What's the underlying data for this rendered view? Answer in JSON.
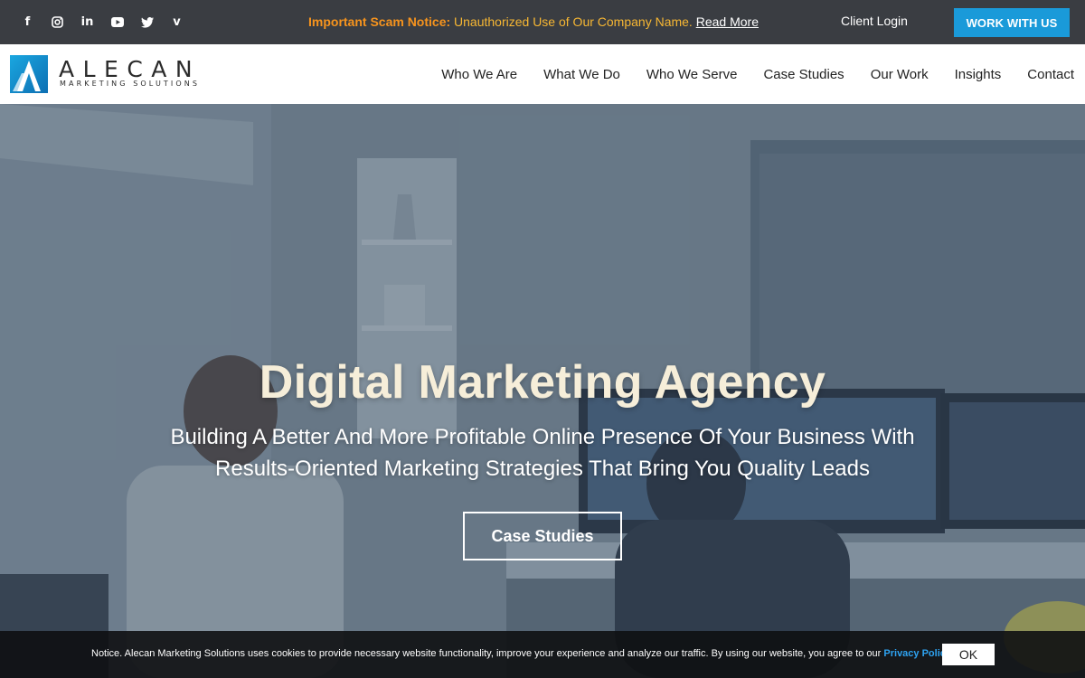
{
  "topbar": {
    "social": [
      {
        "icon": "facebook-icon",
        "glyph": "f"
      },
      {
        "icon": "instagram-icon",
        "glyph": ""
      },
      {
        "icon": "linkedin-icon",
        "glyph": "in"
      },
      {
        "icon": "youtube-icon",
        "glyph": ""
      },
      {
        "icon": "twitter-icon",
        "glyph": ""
      },
      {
        "icon": "vimeo-icon",
        "glyph": "v"
      }
    ],
    "notice_strong": "Important Scam Notice:",
    "notice_text": "Unauthorized Use of Our Company Name.",
    "notice_link": "Read More",
    "client_login": "Client Login",
    "work_button": "WORK WITH US"
  },
  "header": {
    "logo_word": "ALECAN",
    "logo_sub": "MARKETING SOLUTIONS",
    "nav": [
      "Who We Are",
      "What We Do",
      "Who We Serve",
      "Case Studies",
      "Our Work",
      "Insights",
      "Contact"
    ]
  },
  "hero": {
    "title": "Digital Marketing Agency",
    "subtitle": "Building A Better And More Profitable Online Presence Of Your Business With Results-Oriented Marketing Strategies That Bring You Quality Leads",
    "button": "Case Studies"
  },
  "cookie": {
    "text": "Notice. Alecan Marketing Solutions uses cookies to provide necessary website functionality, improve your experience and analyze our traffic. By using our website, you agree to our ",
    "link": "Privacy Policy",
    "ok": "OK"
  },
  "colors": {
    "topbar_bg": "#3a3d42",
    "accent_blue": "#1a9ad9",
    "notice_orange": "#f7941d",
    "hero_title": "#f6eed9"
  }
}
